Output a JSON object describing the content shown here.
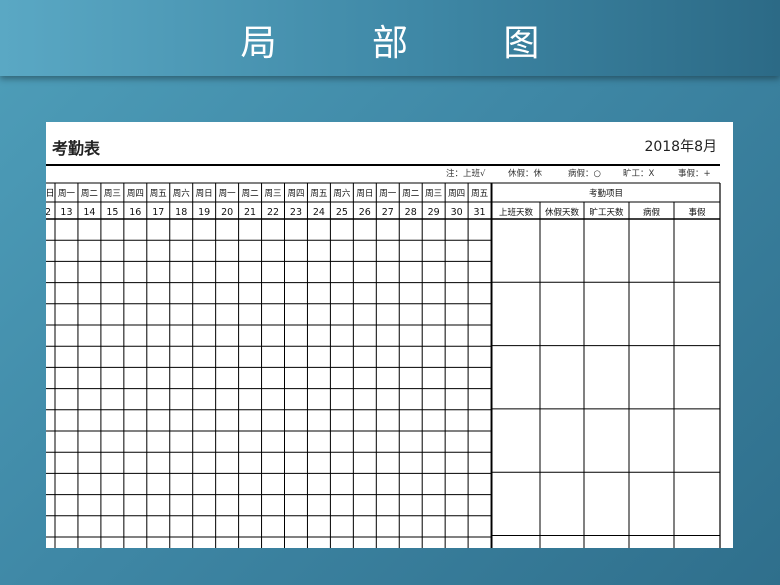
{
  "page_title": "局 部 图",
  "sheet": {
    "title": "考勤表",
    "date": "2018年8月",
    "legend": {
      "attend": "注：上班√",
      "rest": "休假：休",
      "sick": "病假：○",
      "absent": "旷工：X",
      "personal": "事假：+"
    },
    "partial_first_weekday": "日",
    "partial_first_day": "2",
    "weekdays": [
      "周一",
      "周二",
      "周三",
      "周四",
      "周五",
      "周六",
      "周日",
      "周一",
      "周二",
      "周三",
      "周四",
      "周五",
      "周六",
      "周日",
      "周一",
      "周二",
      "周三",
      "周四",
      "周五"
    ],
    "days": [
      "13",
      "14",
      "15",
      "16",
      "17",
      "18",
      "19",
      "20",
      "21",
      "22",
      "23",
      "24",
      "25",
      "26",
      "27",
      "28",
      "29",
      "30",
      "31"
    ],
    "summary_header": "考勤项目",
    "summary_columns": [
      "上班天数",
      "休假天数",
      "旷工天数",
      "病假",
      "事假"
    ]
  }
}
